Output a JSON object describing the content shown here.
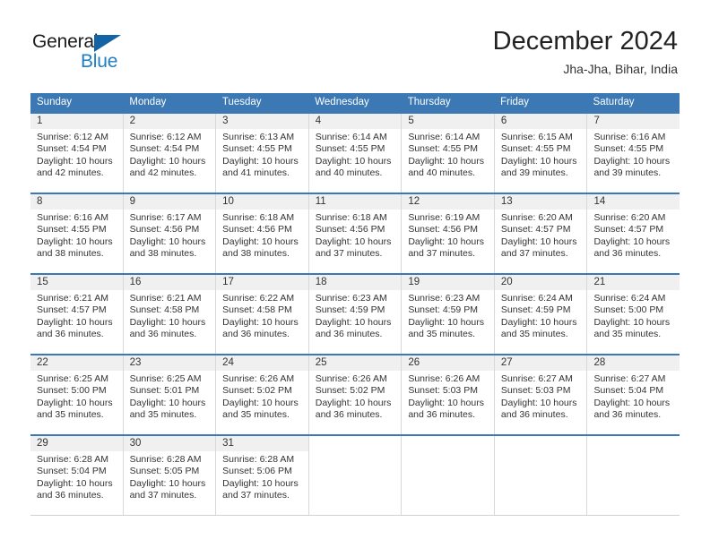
{
  "brand": {
    "name_part1": "General",
    "name_part2": "Blue",
    "triangle_icon": "triangle-icon",
    "color_dark": "#1b1b1b",
    "color_blue": "#1f7ec4"
  },
  "header": {
    "title": "December 2024",
    "subtitle": "Jha-Jha, Bihar, India"
  },
  "theme": {
    "header_blue": "#3b78b4",
    "day_band_gray": "#f0f0f0",
    "grid_line": "#d8d8d8"
  },
  "weekdays": [
    "Sunday",
    "Monday",
    "Tuesday",
    "Wednesday",
    "Thursday",
    "Friday",
    "Saturday"
  ],
  "weeks": [
    [
      {
        "day": "1",
        "sunrise": "Sunrise: 6:12 AM",
        "sunset": "Sunset: 4:54 PM",
        "daylight_line1": "Daylight: 10 hours",
        "daylight_line2": "and 42 minutes."
      },
      {
        "day": "2",
        "sunrise": "Sunrise: 6:12 AM",
        "sunset": "Sunset: 4:54 PM",
        "daylight_line1": "Daylight: 10 hours",
        "daylight_line2": "and 42 minutes."
      },
      {
        "day": "3",
        "sunrise": "Sunrise: 6:13 AM",
        "sunset": "Sunset: 4:55 PM",
        "daylight_line1": "Daylight: 10 hours",
        "daylight_line2": "and 41 minutes."
      },
      {
        "day": "4",
        "sunrise": "Sunrise: 6:14 AM",
        "sunset": "Sunset: 4:55 PM",
        "daylight_line1": "Daylight: 10 hours",
        "daylight_line2": "and 40 minutes."
      },
      {
        "day": "5",
        "sunrise": "Sunrise: 6:14 AM",
        "sunset": "Sunset: 4:55 PM",
        "daylight_line1": "Daylight: 10 hours",
        "daylight_line2": "and 40 minutes."
      },
      {
        "day": "6",
        "sunrise": "Sunrise: 6:15 AM",
        "sunset": "Sunset: 4:55 PM",
        "daylight_line1": "Daylight: 10 hours",
        "daylight_line2": "and 39 minutes."
      },
      {
        "day": "7",
        "sunrise": "Sunrise: 6:16 AM",
        "sunset": "Sunset: 4:55 PM",
        "daylight_line1": "Daylight: 10 hours",
        "daylight_line2": "and 39 minutes."
      }
    ],
    [
      {
        "day": "8",
        "sunrise": "Sunrise: 6:16 AM",
        "sunset": "Sunset: 4:55 PM",
        "daylight_line1": "Daylight: 10 hours",
        "daylight_line2": "and 38 minutes."
      },
      {
        "day": "9",
        "sunrise": "Sunrise: 6:17 AM",
        "sunset": "Sunset: 4:56 PM",
        "daylight_line1": "Daylight: 10 hours",
        "daylight_line2": "and 38 minutes."
      },
      {
        "day": "10",
        "sunrise": "Sunrise: 6:18 AM",
        "sunset": "Sunset: 4:56 PM",
        "daylight_line1": "Daylight: 10 hours",
        "daylight_line2": "and 38 minutes."
      },
      {
        "day": "11",
        "sunrise": "Sunrise: 6:18 AM",
        "sunset": "Sunset: 4:56 PM",
        "daylight_line1": "Daylight: 10 hours",
        "daylight_line2": "and 37 minutes."
      },
      {
        "day": "12",
        "sunrise": "Sunrise: 6:19 AM",
        "sunset": "Sunset: 4:56 PM",
        "daylight_line1": "Daylight: 10 hours",
        "daylight_line2": "and 37 minutes."
      },
      {
        "day": "13",
        "sunrise": "Sunrise: 6:20 AM",
        "sunset": "Sunset: 4:57 PM",
        "daylight_line1": "Daylight: 10 hours",
        "daylight_line2": "and 37 minutes."
      },
      {
        "day": "14",
        "sunrise": "Sunrise: 6:20 AM",
        "sunset": "Sunset: 4:57 PM",
        "daylight_line1": "Daylight: 10 hours",
        "daylight_line2": "and 36 minutes."
      }
    ],
    [
      {
        "day": "15",
        "sunrise": "Sunrise: 6:21 AM",
        "sunset": "Sunset: 4:57 PM",
        "daylight_line1": "Daylight: 10 hours",
        "daylight_line2": "and 36 minutes."
      },
      {
        "day": "16",
        "sunrise": "Sunrise: 6:21 AM",
        "sunset": "Sunset: 4:58 PM",
        "daylight_line1": "Daylight: 10 hours",
        "daylight_line2": "and 36 minutes."
      },
      {
        "day": "17",
        "sunrise": "Sunrise: 6:22 AM",
        "sunset": "Sunset: 4:58 PM",
        "daylight_line1": "Daylight: 10 hours",
        "daylight_line2": "and 36 minutes."
      },
      {
        "day": "18",
        "sunrise": "Sunrise: 6:23 AM",
        "sunset": "Sunset: 4:59 PM",
        "daylight_line1": "Daylight: 10 hours",
        "daylight_line2": "and 36 minutes."
      },
      {
        "day": "19",
        "sunrise": "Sunrise: 6:23 AM",
        "sunset": "Sunset: 4:59 PM",
        "daylight_line1": "Daylight: 10 hours",
        "daylight_line2": "and 35 minutes."
      },
      {
        "day": "20",
        "sunrise": "Sunrise: 6:24 AM",
        "sunset": "Sunset: 4:59 PM",
        "daylight_line1": "Daylight: 10 hours",
        "daylight_line2": "and 35 minutes."
      },
      {
        "day": "21",
        "sunrise": "Sunrise: 6:24 AM",
        "sunset": "Sunset: 5:00 PM",
        "daylight_line1": "Daylight: 10 hours",
        "daylight_line2": "and 35 minutes."
      }
    ],
    [
      {
        "day": "22",
        "sunrise": "Sunrise: 6:25 AM",
        "sunset": "Sunset: 5:00 PM",
        "daylight_line1": "Daylight: 10 hours",
        "daylight_line2": "and 35 minutes."
      },
      {
        "day": "23",
        "sunrise": "Sunrise: 6:25 AM",
        "sunset": "Sunset: 5:01 PM",
        "daylight_line1": "Daylight: 10 hours",
        "daylight_line2": "and 35 minutes."
      },
      {
        "day": "24",
        "sunrise": "Sunrise: 6:26 AM",
        "sunset": "Sunset: 5:02 PM",
        "daylight_line1": "Daylight: 10 hours",
        "daylight_line2": "and 35 minutes."
      },
      {
        "day": "25",
        "sunrise": "Sunrise: 6:26 AM",
        "sunset": "Sunset: 5:02 PM",
        "daylight_line1": "Daylight: 10 hours",
        "daylight_line2": "and 36 minutes."
      },
      {
        "day": "26",
        "sunrise": "Sunrise: 6:26 AM",
        "sunset": "Sunset: 5:03 PM",
        "daylight_line1": "Daylight: 10 hours",
        "daylight_line2": "and 36 minutes."
      },
      {
        "day": "27",
        "sunrise": "Sunrise: 6:27 AM",
        "sunset": "Sunset: 5:03 PM",
        "daylight_line1": "Daylight: 10 hours",
        "daylight_line2": "and 36 minutes."
      },
      {
        "day": "28",
        "sunrise": "Sunrise: 6:27 AM",
        "sunset": "Sunset: 5:04 PM",
        "daylight_line1": "Daylight: 10 hours",
        "daylight_line2": "and 36 minutes."
      }
    ],
    [
      {
        "day": "29",
        "sunrise": "Sunrise: 6:28 AM",
        "sunset": "Sunset: 5:04 PM",
        "daylight_line1": "Daylight: 10 hours",
        "daylight_line2": "and 36 minutes."
      },
      {
        "day": "30",
        "sunrise": "Sunrise: 6:28 AM",
        "sunset": "Sunset: 5:05 PM",
        "daylight_line1": "Daylight: 10 hours",
        "daylight_line2": "and 37 minutes."
      },
      {
        "day": "31",
        "sunrise": "Sunrise: 6:28 AM",
        "sunset": "Sunset: 5:06 PM",
        "daylight_line1": "Daylight: 10 hours",
        "daylight_line2": "and 37 minutes."
      },
      {
        "day": "",
        "sunrise": "",
        "sunset": "",
        "daylight_line1": "",
        "daylight_line2": ""
      },
      {
        "day": "",
        "sunrise": "",
        "sunset": "",
        "daylight_line1": "",
        "daylight_line2": ""
      },
      {
        "day": "",
        "sunrise": "",
        "sunset": "",
        "daylight_line1": "",
        "daylight_line2": ""
      },
      {
        "day": "",
        "sunrise": "",
        "sunset": "",
        "daylight_line1": "",
        "daylight_line2": ""
      }
    ]
  ]
}
